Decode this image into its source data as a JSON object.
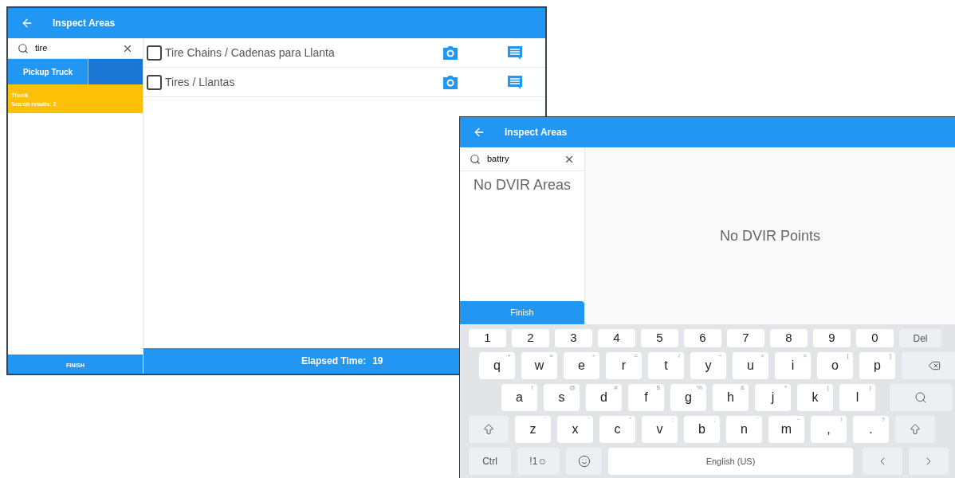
{
  "screen_1": {
    "title": "Inspect Areas",
    "search": {
      "value": "tire"
    },
    "tabs": [
      {
        "label": "Pickup Truck",
        "selected": false
      }
    ],
    "areas": [
      {
        "name": "Truck",
        "detail": "Search results: 2",
        "selected": true
      }
    ],
    "points": [
      {
        "label": "Tire Chains / Cadenas para Llanta",
        "checked": false
      },
      {
        "label": "Tires / Llantas",
        "checked": false
      }
    ],
    "finish": "FINISH",
    "elapsed_label": "Elapsed Time:",
    "elapsed_value": "19"
  },
  "screen_2": {
    "title": "Inspect Areas",
    "search": {
      "value": "battry"
    },
    "areas_empty": "No DVIR Areas",
    "points_empty": "No DVIR Points",
    "finish": "Finish",
    "keyboard": [
      [
        {
          "kind": "num",
          "label": "1"
        },
        {
          "kind": "num",
          "label": "2"
        },
        {
          "kind": "num",
          "label": "3"
        },
        {
          "kind": "num",
          "label": "4"
        },
        {
          "kind": "num",
          "label": "5"
        },
        {
          "kind": "num",
          "label": "6"
        },
        {
          "kind": "num",
          "label": "7"
        },
        {
          "kind": "num",
          "label": "8"
        },
        {
          "kind": "num",
          "label": "9"
        },
        {
          "kind": "num",
          "label": "0"
        },
        {
          "kind": "action",
          "label": "Del"
        }
      ],
      [
        {
          "kind": "char",
          "label": "q",
          "hint": "+"
        },
        {
          "kind": "char",
          "label": "w",
          "hint": "×"
        },
        {
          "kind": "char",
          "label": "e",
          "hint": "÷"
        },
        {
          "kind": "char",
          "label": "r",
          "hint": "="
        },
        {
          "kind": "char",
          "label": "t",
          "hint": "/"
        },
        {
          "kind": "char",
          "label": "y",
          "hint": "−"
        },
        {
          "kind": "char",
          "label": "u",
          "hint": "<"
        },
        {
          "kind": "char",
          "label": "i",
          "hint": ">"
        },
        {
          "kind": "char",
          "label": "o",
          "hint": "["
        },
        {
          "kind": "char",
          "label": "p",
          "hint": "]"
        },
        {
          "kind": "backspace"
        }
      ],
      [
        {
          "kind": "char",
          "label": "a",
          "hint": "!"
        },
        {
          "kind": "char",
          "label": "s",
          "hint": "@"
        },
        {
          "kind": "char",
          "label": "d",
          "hint": "#"
        },
        {
          "kind": "char",
          "label": "f",
          "hint": "$"
        },
        {
          "kind": "char",
          "label": "g",
          "hint": "%"
        },
        {
          "kind": "char",
          "label": "h",
          "hint": "&"
        },
        {
          "kind": "char",
          "label": "j",
          "hint": "*"
        },
        {
          "kind": "char",
          "label": "k",
          "hint": "("
        },
        {
          "kind": "char",
          "label": "l",
          "hint": ")"
        },
        {
          "kind": "search"
        }
      ],
      [
        {
          "kind": "shift"
        },
        {
          "kind": "char",
          "label": "z",
          "hint": "`"
        },
        {
          "kind": "char",
          "label": "x",
          "hint": "'"
        },
        {
          "kind": "char",
          "label": "c",
          "hint": "\""
        },
        {
          "kind": "char",
          "label": "v",
          "hint": ":"
        },
        {
          "kind": "char",
          "label": "b",
          "hint": ";"
        },
        {
          "kind": "char",
          "label": "n",
          "hint": "'"
        },
        {
          "kind": "char",
          "label": "m",
          "hint": "~"
        },
        {
          "kind": "char",
          "label": ",",
          "hint": "!"
        },
        {
          "kind": "char",
          "label": ".",
          "hint": "?"
        },
        {
          "kind": "shift"
        }
      ],
      [
        {
          "kind": "action",
          "label": "Ctrl"
        },
        {
          "kind": "action",
          "label": "!1☺"
        },
        {
          "kind": "emoji"
        },
        {
          "kind": "space",
          "label": "English (US)"
        },
        {
          "kind": "left"
        },
        {
          "kind": "right"
        }
      ]
    ]
  }
}
